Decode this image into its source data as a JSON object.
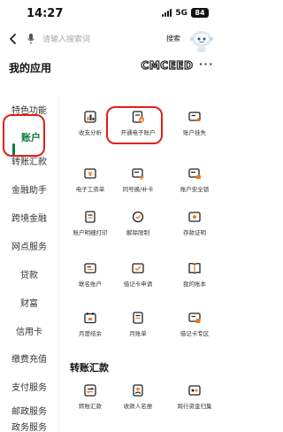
{
  "status": {
    "time": "14:27",
    "network": "5G",
    "battery": "84"
  },
  "search": {
    "placeholder": "请输入搜索词",
    "button": "搜索"
  },
  "page": {
    "title": "我的应用",
    "brand": "CMCEED",
    "more": "···"
  },
  "sidebar": {
    "items": [
      {
        "label": "特色功能"
      },
      {
        "label": "账户"
      },
      {
        "label": "转账汇款"
      },
      {
        "label": "金融助手"
      },
      {
        "label": "跨境金融"
      },
      {
        "label": "网点服务"
      },
      {
        "label": "贷款"
      },
      {
        "label": "财富"
      },
      {
        "label": "信用卡"
      },
      {
        "label": "缴费充值"
      },
      {
        "label": "支付服务"
      },
      {
        "label": "邮政服务"
      },
      {
        "label": "政务服务"
      }
    ],
    "active_index": 1
  },
  "account_section": {
    "items": [
      {
        "label": "收支分析",
        "icon": "chart-icon"
      },
      {
        "label": "开通电子账户",
        "icon": "e-account-icon"
      },
      {
        "label": "账户挂失",
        "icon": "report-loss-icon"
      },
      {
        "label": "电子工资单",
        "icon": "payslip-icon"
      },
      {
        "label": "同号换/补卡",
        "icon": "card-replace-icon"
      },
      {
        "label": "账户安全锁",
        "icon": "security-lock-icon"
      },
      {
        "label": "账户明细打印",
        "icon": "print-icon"
      },
      {
        "label": "解除限制",
        "icon": "unlock-icon"
      },
      {
        "label": "存款证明",
        "icon": "deposit-proof-icon"
      },
      {
        "label": "联名账户",
        "icon": "joint-account-icon"
      },
      {
        "label": "借记卡申请",
        "icon": "debit-apply-icon"
      },
      {
        "label": "我的账本",
        "icon": "ledger-icon"
      },
      {
        "label": "月度结余",
        "icon": "monthly-balance-icon"
      },
      {
        "label": "月账单",
        "icon": "monthly-bill-icon"
      },
      {
        "label": "借记卡专区",
        "icon": "debit-zone-icon"
      }
    ]
  },
  "transfer_section": {
    "title": "转账汇款",
    "items": [
      {
        "label": "转账汇款",
        "icon": "transfer-icon"
      },
      {
        "label": "收款人名册",
        "icon": "payee-list-icon"
      },
      {
        "label": "跨行资金归集",
        "icon": "fund-collection-icon"
      }
    ]
  },
  "colors": {
    "accent": "#0b7a3e",
    "highlight": "#e0201a",
    "icon_orange": "#f07a1a"
  }
}
